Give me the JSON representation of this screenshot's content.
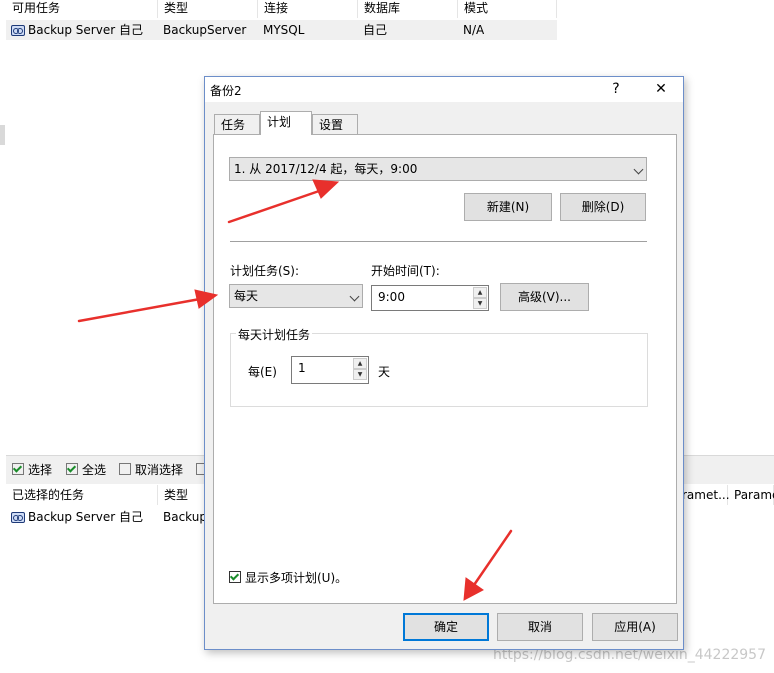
{
  "top_table": {
    "columns": [
      "可用任务",
      "类型",
      "连接",
      "数据库",
      "模式"
    ],
    "rows": [
      {
        "task": "Backup Server 自己",
        "type": "BackupServer",
        "connection": "MYSQL",
        "database": "自己",
        "mode": "N/A"
      }
    ]
  },
  "bottom_toolbar": {
    "select": "选择",
    "select_all": "全选",
    "deselect": "取消选择"
  },
  "bottom_table": {
    "columns": [
      "已选择的任务",
      "类型",
      "ramet...",
      "Parame"
    ],
    "rows": [
      {
        "task": "Backup Server 自己",
        "type": "Backup"
      }
    ]
  },
  "dialog": {
    "title": "备份2",
    "help": "?",
    "close": "✕",
    "tabs": [
      "任务",
      "计划",
      "设置"
    ],
    "active_tab": "计划",
    "schedule_combo": "1. 从 2017/12/4 起，每天，9:00",
    "new_button": "新建(N)",
    "delete_button": "删除(D)",
    "schedule_task_label": "计划任务(S):",
    "schedule_task_value": "每天",
    "start_time_label": "开始时间(T):",
    "start_time_value": "9:00",
    "advanced_button": "高级(V)...",
    "group_title": "每天计划任务",
    "every_label": "每(E)",
    "every_value": "1",
    "day_unit": "天",
    "show_multiple": "显示多项计划(U)。",
    "show_multiple_checked": true,
    "ok_button": "确定",
    "cancel_button": "取消",
    "apply_button": "应用(A)"
  },
  "watermark": "https://blog.csdn.net/weixin_44222957",
  "colors": {
    "arrow": "#e8302c",
    "accent": "#0078d7",
    "dialog_bg": "#f0f0f0"
  }
}
